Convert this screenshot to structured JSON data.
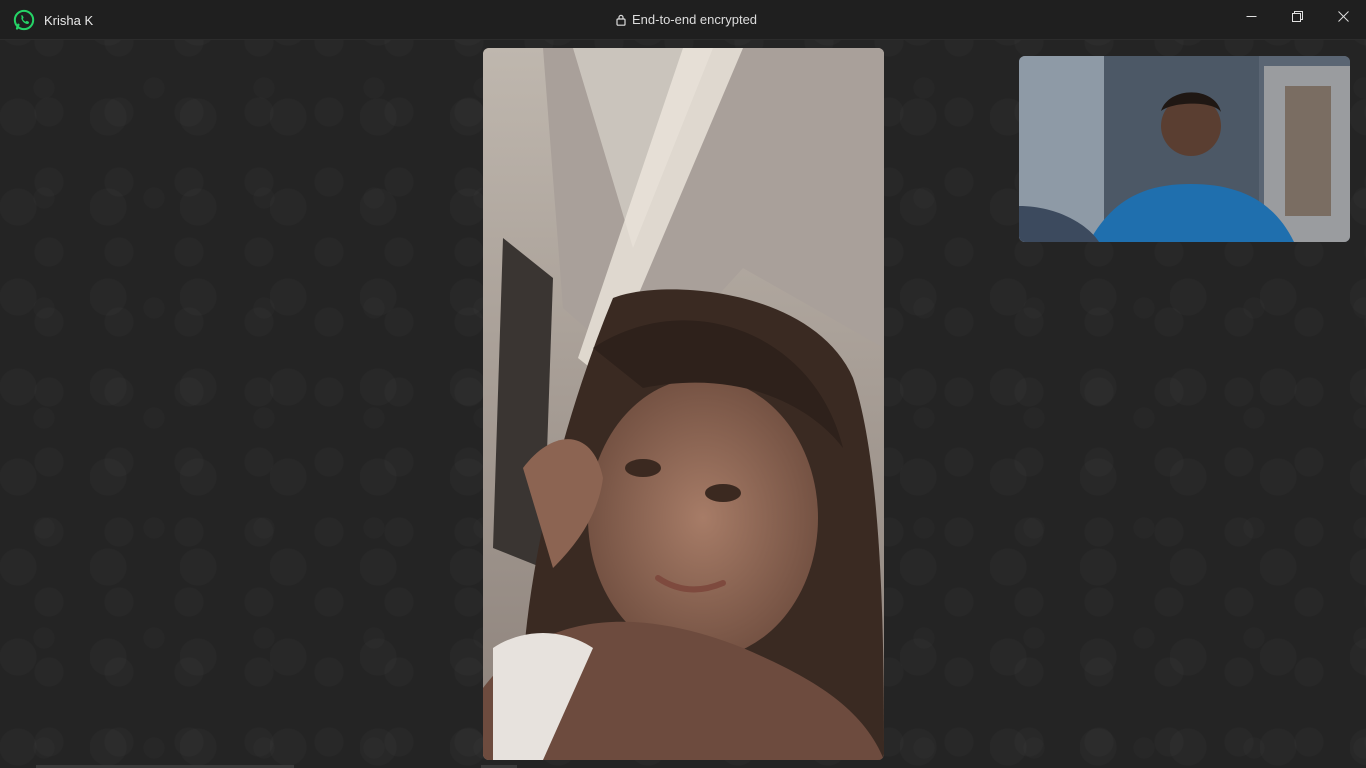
{
  "titlebar": {
    "contact_name": "Krisha K",
    "encryption_text": "End-to-end encrypted",
    "app_icon": "whatsapp-icon",
    "lock_icon": "lock-icon",
    "minimize_icon": "minimize-icon",
    "restore_icon": "restore-icon",
    "close_icon": "close-icon"
  },
  "colors": {
    "brand": "#25D366",
    "background": "#242424",
    "titlebar": "#1f1f1f",
    "text": "#e9e9e9"
  },
  "call": {
    "remote_video": "remote-participant-video",
    "self_video": "self-preview-video"
  }
}
